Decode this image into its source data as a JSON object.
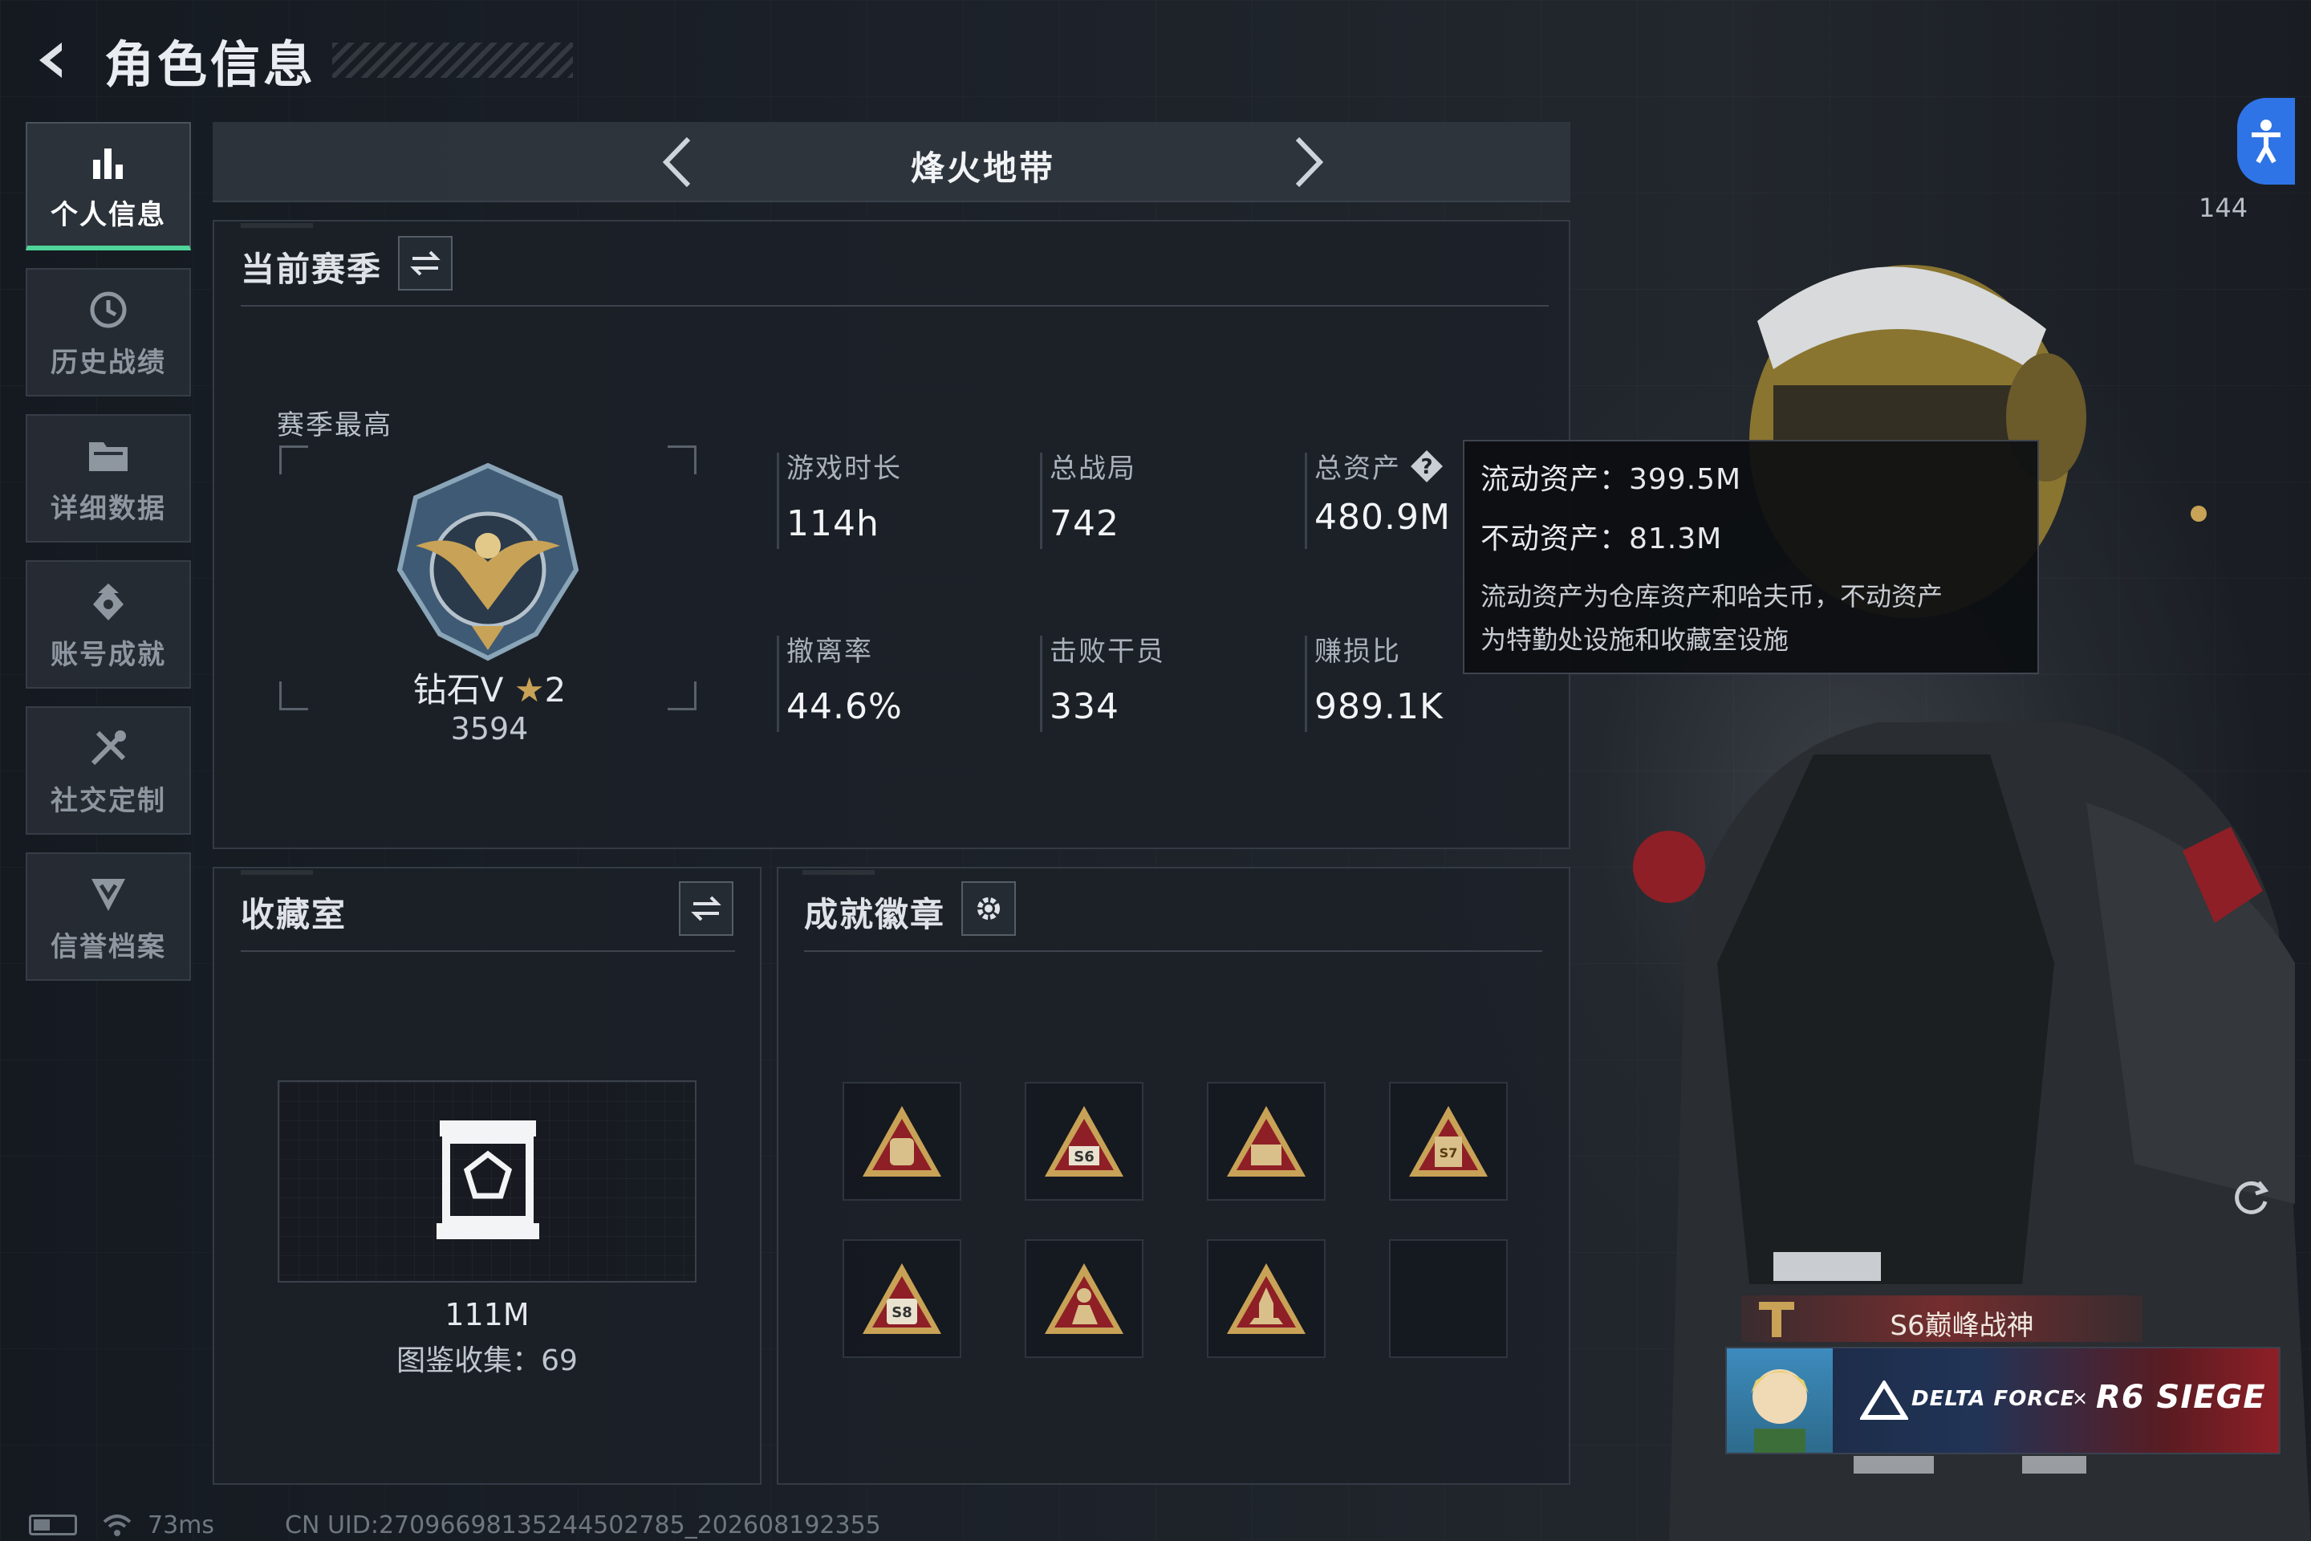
{
  "header": {
    "title": "角色信息"
  },
  "sidebar": {
    "items": [
      {
        "label": "个人信息",
        "icon": "bar-chart-icon",
        "active": true
      },
      {
        "label": "历史战绩",
        "icon": "history-clock-icon",
        "active": false
      },
      {
        "label": "详细数据",
        "icon": "folder-icon",
        "active": false
      },
      {
        "label": "账号成就",
        "icon": "achievement-icon",
        "active": false
      },
      {
        "label": "社交定制",
        "icon": "tools-icon",
        "active": false
      },
      {
        "label": "信誉档案",
        "icon": "credit-shield-icon",
        "active": false
      }
    ]
  },
  "mode": {
    "title": "烽火地带"
  },
  "season": {
    "title": "当前赛季",
    "best_label": "赛季最高",
    "rank_name": "钻石V",
    "rank_stars": "2",
    "rank_score": "3594",
    "stats": [
      {
        "label": "游戏时长",
        "value": "114h"
      },
      {
        "label": "总战局",
        "value": "742"
      },
      {
        "label": "总资产",
        "value": "480.9M"
      },
      {
        "label": "撤离率",
        "value": "44.6%"
      },
      {
        "label": "击败干员",
        "value": "334"
      },
      {
        "label": "赚损比",
        "value": "989.1K"
      }
    ]
  },
  "tooltip": {
    "liquid": "流动资产：399.5M",
    "fixed": "不动资产：81.3M",
    "note_line1": "流动资产为仓库资产和哈夫币，不动资产",
    "note_line2": "为特勤处设施和收藏室设施"
  },
  "collection": {
    "title": "收藏室",
    "value": "111M",
    "count": "图鉴收集：69"
  },
  "badges": {
    "title": "成就徽章",
    "items": [
      {
        "icon": "backpack-badge-icon",
        "empty": false
      },
      {
        "icon": "s6-badge-icon",
        "empty": false
      },
      {
        "icon": "crate-badge-icon",
        "empty": false
      },
      {
        "icon": "s7-badge-icon",
        "empty": false
      },
      {
        "icon": "s8-badge-icon",
        "empty": false
      },
      {
        "icon": "figure-badge-icon",
        "empty": false
      },
      {
        "icon": "rocket-badge-icon",
        "empty": false
      },
      {
        "icon": "empty-slot",
        "empty": true
      }
    ]
  },
  "profile": {
    "side_count": "144",
    "title_tag": "S6巅峰战神",
    "collab_left": "DELTA FORCE",
    "collab_x": "×",
    "collab_right": "R6 SIEGE"
  },
  "status": {
    "ping": "73ms",
    "uid": "CN UID:2709669813524450278​5_202608192355"
  },
  "colors": {
    "accent_green": "#4fd49a",
    "accessibility_blue": "#2f74e6",
    "badge_red": "#8e1f26",
    "badge_gold": "#c8a256"
  }
}
